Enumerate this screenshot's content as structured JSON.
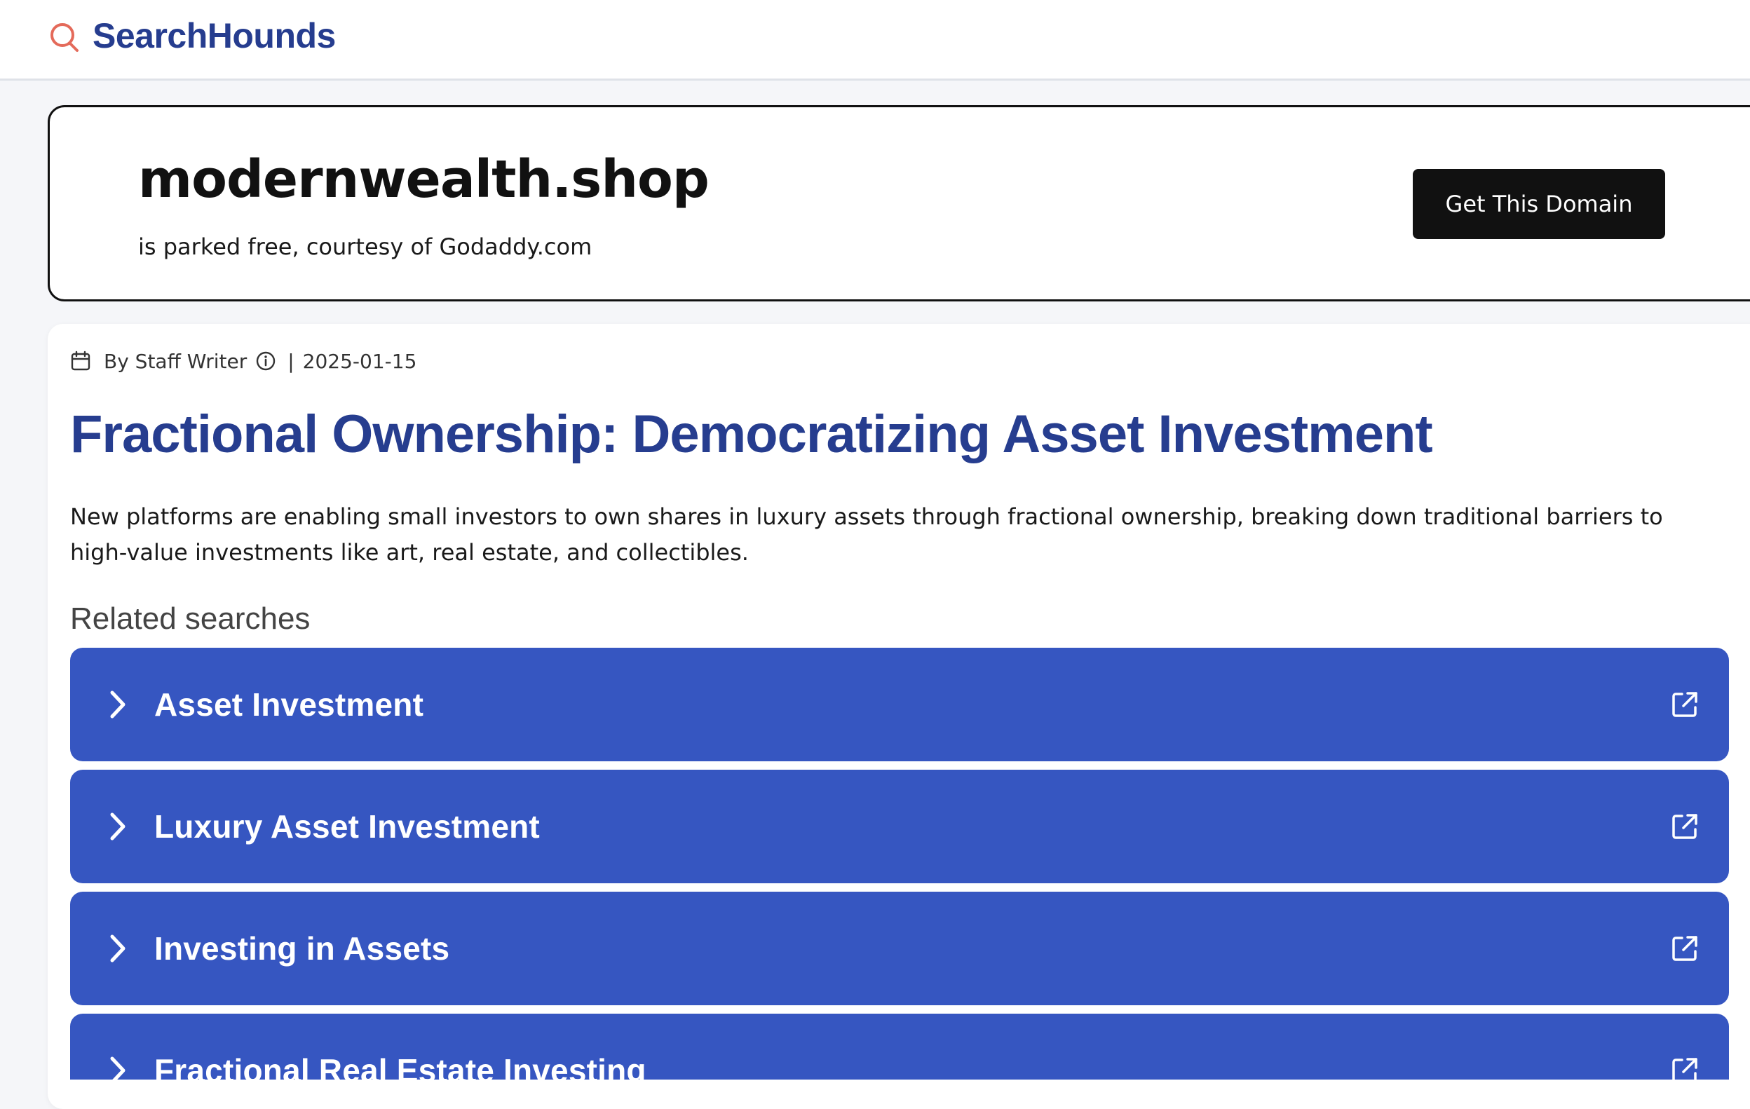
{
  "header": {
    "logo_text": "SearchHounds",
    "logo_icon": "search-icon",
    "logo_icon_color": "#e46a5a",
    "brand_color": "#263d8f"
  },
  "domain_banner": {
    "domain": "modernwealth.shop",
    "subtitle": "is parked free, courtesy of Godaddy.com",
    "cta_label": "Get This Domain"
  },
  "article": {
    "author": "By Staff Writer",
    "date_separator": "|",
    "date": "2025-01-15",
    "title": "Fractional Ownership: Democratizing Asset Investment",
    "summary": "New platforms are enabling small investors to own shares in luxury assets through fractional ownership, breaking down traditional barriers to high-value investments like art, real estate, and collectibles."
  },
  "related": {
    "heading": "Related searches",
    "item_color": "#3656c1",
    "items": [
      {
        "label": "Asset Investment"
      },
      {
        "label": "Luxury Asset Investment"
      },
      {
        "label": "Investing in Assets"
      },
      {
        "label": "Fractional Real Estate Investing"
      }
    ]
  }
}
